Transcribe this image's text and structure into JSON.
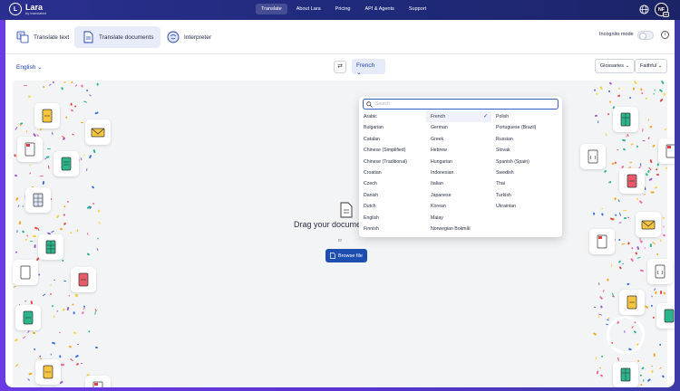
{
  "app": {
    "logo_mark": "L",
    "name": "Lara",
    "subtitle": "by translated",
    "nav": [
      "Translate",
      "About Lara",
      "Pricing",
      "API & Agents",
      "Support"
    ],
    "avatar_initials": "NF",
    "avatar_badge": "14"
  },
  "modes": [
    {
      "label": "Translate text",
      "icon": "translate-text-icon"
    },
    {
      "label": "Translate documents",
      "icon": "document-icon"
    },
    {
      "label": "Interpreter",
      "icon": "interpreter-icon"
    }
  ],
  "incognito_label": "Incognito mode",
  "info_glyph": "i",
  "source_language": "English",
  "target_language": "French",
  "swap_glyph": "⇄",
  "glossaries_label": "Glossaries",
  "style_label": "Faithful",
  "dropzone": {
    "title": "Drag your document here",
    "or": "or",
    "browse_label": "Browse file"
  },
  "language_dropdown": {
    "search_placeholder": "Search",
    "selected": "French",
    "columns": [
      [
        "Arabic",
        "Bulgarian",
        "Catalan",
        "Chinese (Simplified)",
        "Chinese (Traditional)",
        "Croatian",
        "Czech",
        "Danish",
        "Dutch",
        "English",
        "Finnish"
      ],
      [
        "French",
        "German",
        "Greek",
        "Hebrew",
        "Hungarian",
        "Indonesian",
        "Italian",
        "Japanese",
        "Korean",
        "Malay",
        "Norwegian Bokmål"
      ],
      [
        "Polish",
        "Portuguese (Brazil)",
        "Russian",
        "Slovak",
        "Spanish (Spain)",
        "Swedish",
        "Thai",
        "Turkish",
        "Ukrainian"
      ]
    ]
  },
  "colors": {
    "accent": "#1e40af",
    "button": "#1e4fb0",
    "header": "#1f2a7a",
    "frame": "#5a34d4"
  }
}
